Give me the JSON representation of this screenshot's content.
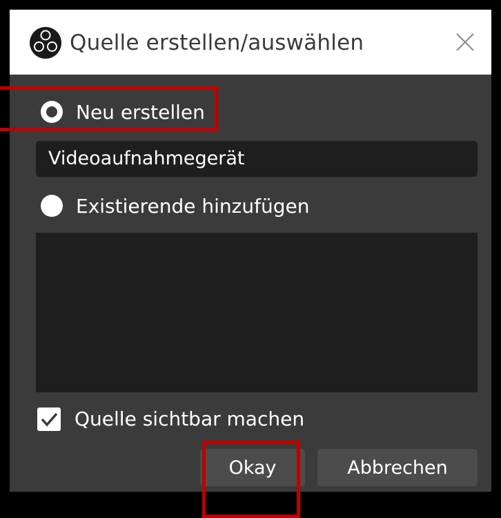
{
  "dialog": {
    "title": "Quelle erstellen/auswählen",
    "app_icon": "obs-logo-icon",
    "close_icon": "close-icon"
  },
  "options": {
    "create_new_label": "Neu erstellen",
    "create_new_selected": true,
    "new_source_name": "Videoaufnahmegerät",
    "add_existing_label": "Existierende hinzufügen",
    "add_existing_selected": false,
    "existing_sources": []
  },
  "visibility": {
    "label": "Quelle sichtbar machen",
    "checked": true
  },
  "buttons": {
    "ok_label": "Okay",
    "cancel_label": "Abbrechen"
  },
  "colors": {
    "panel_bg": "#3b3b3b",
    "field_bg": "#1e1e1e",
    "button_bg": "#4c4c4c",
    "highlight": "#c00000"
  }
}
